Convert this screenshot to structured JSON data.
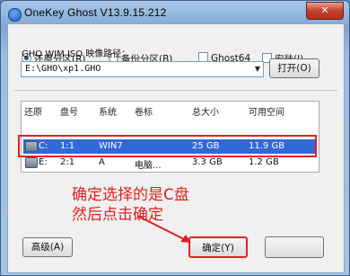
{
  "window": {
    "title": "OneKey Ghost V13.9.15.212",
    "close_label": "✕"
  },
  "options": {
    "restore": "还原分区(R)",
    "backup": "备份分区(B)",
    "ghost64": "Ghost64",
    "install": "安装(I)"
  },
  "path": {
    "label": "GHO WIM ISO 映像路径：",
    "value": "E:\\GHO\\xp1.GHO",
    "open_button": "打开(O)"
  },
  "table": {
    "headers": [
      "还原",
      "盘号",
      "系统",
      "卷标",
      "总大小",
      "可用空间"
    ],
    "rows": [
      {
        "drive": "C:",
        "num": "1:1",
        "system": "WIN7",
        "label": "",
        "total": "25 GB",
        "free": "11.9 GB"
      },
      {
        "drive": "E:",
        "num": "2:1",
        "system": "A",
        "label": "电脑...",
        "total": "3.3 GB",
        "free": "1.2 GB"
      }
    ]
  },
  "annotation": {
    "line1": "确定选择的是C盘",
    "line2": "然后点击确定"
  },
  "buttons": {
    "advanced": "高级(A)",
    "ok": "确定(Y)",
    "cancel": ""
  }
}
